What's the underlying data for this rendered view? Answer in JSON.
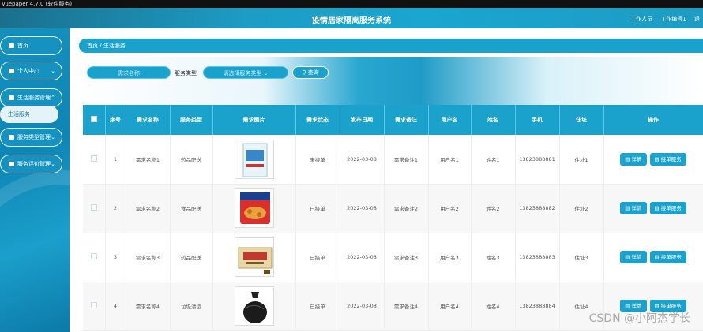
{
  "window_title": "Vuepaper 4.7.0 (软件服务)",
  "header": {
    "title": "疫情居家隔离服务系统",
    "user_role": "工作人员",
    "user_name": "工作编号1",
    "logout": "退"
  },
  "sidebar": {
    "items": [
      {
        "label": "首页"
      },
      {
        "label": "个人中心"
      },
      {
        "label": "生活服务管理"
      },
      {
        "label": "服务类型管理"
      },
      {
        "label": "服务评价管理"
      }
    ],
    "submenu_label": "生活服务"
  },
  "breadcrumb": {
    "home": "首页",
    "sep": "/",
    "current": "生活服务"
  },
  "search": {
    "name_placeholder": "需求名称",
    "type_label": "服务类型",
    "type_placeholder": "请选择服务类型",
    "button": "查询"
  },
  "table": {
    "headers": [
      "序号",
      "需求名称",
      "服务类型",
      "需求图片",
      "需求状态",
      "发布日期",
      "需求备注",
      "用户名",
      "姓名",
      "手机",
      "住址",
      "操作"
    ],
    "rows": [
      {
        "idx": "1",
        "name": "需求名称1",
        "type": "药品配送",
        "status": "未接单",
        "date": "2022-03-08",
        "note": "需求备注1",
        "user": "用户名1",
        "realname": "姓名1",
        "phone": "13823888881",
        "addr": "住址1"
      },
      {
        "idx": "2",
        "name": "需求名称2",
        "type": "食品配送",
        "status": "已接单",
        "date": "2022-03-08",
        "note": "需求备注2",
        "user": "用户名2",
        "realname": "姓名2",
        "phone": "13823888882",
        "addr": "住址2"
      },
      {
        "idx": "3",
        "name": "需求名称3",
        "type": "药品配送",
        "status": "已接单",
        "date": "2022-03-08",
        "note": "需求备注3",
        "user": "用户名3",
        "realname": "姓名3",
        "phone": "13823888883",
        "addr": "住址3"
      },
      {
        "idx": "4",
        "name": "需求名称4",
        "type": "垃圾清运",
        "status": "已接单",
        "date": "2022-03-08",
        "note": "需求备注4",
        "user": "用户名4",
        "realname": "姓名4",
        "phone": "13823888884",
        "addr": "住址4"
      }
    ],
    "op_detail": "详情",
    "op_accept": "接单服务"
  },
  "watermark": "CSDN @小阿杰学长",
  "colors": {
    "accent": "#1aa2cc"
  }
}
